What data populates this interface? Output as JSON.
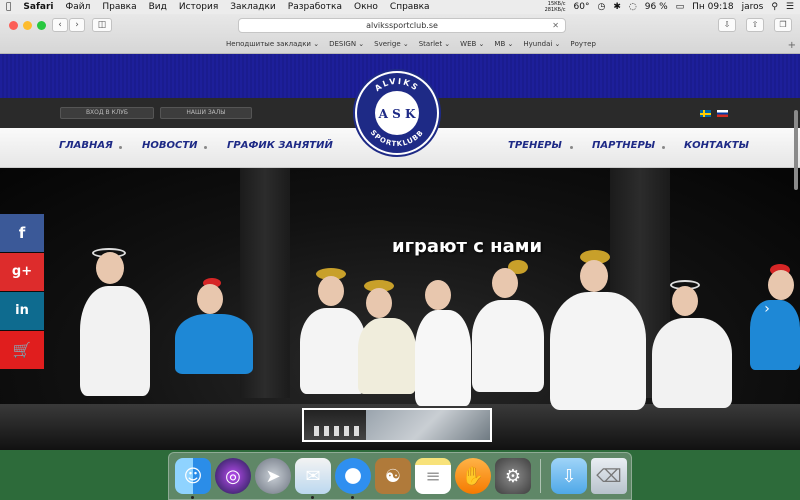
{
  "menubar": {
    "apple": "",
    "items": [
      "Safari",
      "Файл",
      "Правка",
      "Вид",
      "История",
      "Закладки",
      "Разработка",
      "Окно",
      "Справка"
    ],
    "netspeed_up": "15КБ/с",
    "netspeed_down": "281КБ/с",
    "temperature": "60°",
    "battery": "96 %",
    "clock": "Пн 09:18",
    "user": "jaros"
  },
  "browser": {
    "url": "alvikssportclub.se",
    "bookmarks": [
      "Неподшитые закладки",
      "DESIGN",
      "Sverige",
      "Starlet",
      "WEB",
      "MB",
      "Hyundai",
      "Роутер"
    ]
  },
  "site": {
    "top_buttons": [
      "ВХОД В КЛУБ",
      "НАШИ ЗАЛЫ"
    ],
    "logo_top": "ALVIKS",
    "logo_bottom": "SPORTKLUBB",
    "logo_letters": "A S K",
    "nav_left": [
      "ГЛАВНАЯ",
      "НОВОСТИ",
      "ГРАФИК ЗАНЯТИЙ"
    ],
    "nav_right": [
      "ТРЕНЕРЫ",
      "ПАРТНЕРЫ",
      "КОНТАКТЫ"
    ],
    "hero_caption": "играют с нами",
    "social": [
      "f",
      "g+",
      "in",
      "🛒"
    ]
  },
  "colors": {
    "topband": "#1d1f9a",
    "nav_text": "#1e2a86",
    "facebook": "#3b5998",
    "gplus": "#dd2c2c",
    "linkedin": "#0e6b8f",
    "cart": "#e01e1e"
  }
}
